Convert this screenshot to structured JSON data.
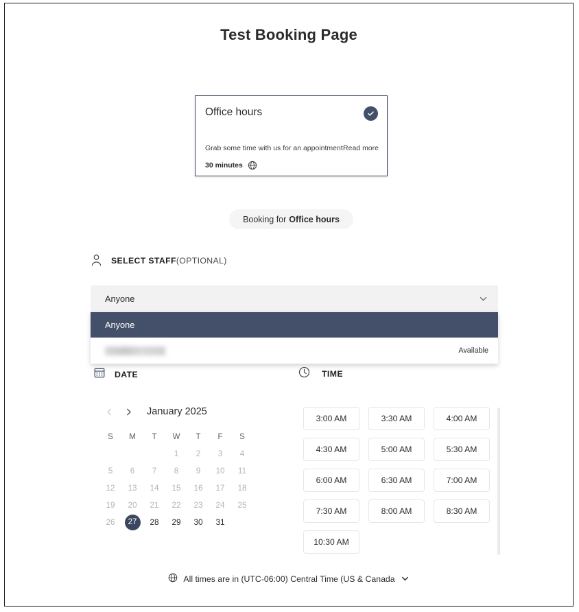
{
  "page": {
    "title": "Test Booking Page"
  },
  "service_card": {
    "title": "Office hours",
    "selected_badge_icon": "check-circle-icon",
    "description": "Grab some time with us for an appointment",
    "read_more_label": "Read more",
    "duration": "30 minutes",
    "duration_icon": "globe-icon",
    "border_color": "#3c485e",
    "badge_color": "#44506a"
  },
  "booking_pill": {
    "prefix": "Booking for",
    "service": "Office hours"
  },
  "staff": {
    "icon": "person-icon",
    "heading": "SELECT STAFF",
    "heading_optional": "(OPTIONAL)",
    "selected_value": "Anyone",
    "chevron_icon": "chevron-down-icon",
    "options": [
      {
        "label": "Anyone",
        "status": "",
        "selected": true,
        "redacted": false
      },
      {
        "label": "",
        "status": "Available",
        "selected": false,
        "redacted": true
      }
    ],
    "highlight_color": "#44506a",
    "field_bg": "#f2f2f2"
  },
  "date_section": {
    "icon": "calendar-icon",
    "label": "DATE"
  },
  "time_section": {
    "icon": "clock-icon",
    "label": "TIME"
  },
  "calendar": {
    "prev_icon": "chevron-left-icon",
    "next_icon": "chevron-right-icon",
    "prev_disabled": true,
    "month_year": "January 2025",
    "weekdays": [
      "S",
      "M",
      "T",
      "W",
      "T",
      "F",
      "S"
    ],
    "leading_blanks": 3,
    "days": [
      {
        "n": "1",
        "state": "disabled"
      },
      {
        "n": "2",
        "state": "disabled"
      },
      {
        "n": "3",
        "state": "disabled"
      },
      {
        "n": "4",
        "state": "disabled"
      },
      {
        "n": "5",
        "state": "disabled"
      },
      {
        "n": "6",
        "state": "disabled"
      },
      {
        "n": "7",
        "state": "disabled"
      },
      {
        "n": "8",
        "state": "disabled"
      },
      {
        "n": "9",
        "state": "disabled"
      },
      {
        "n": "10",
        "state": "disabled"
      },
      {
        "n": "11",
        "state": "disabled"
      },
      {
        "n": "12",
        "state": "disabled"
      },
      {
        "n": "13",
        "state": "disabled"
      },
      {
        "n": "14",
        "state": "disabled"
      },
      {
        "n": "15",
        "state": "disabled"
      },
      {
        "n": "16",
        "state": "disabled"
      },
      {
        "n": "17",
        "state": "disabled"
      },
      {
        "n": "18",
        "state": "disabled"
      },
      {
        "n": "19",
        "state": "disabled"
      },
      {
        "n": "20",
        "state": "disabled"
      },
      {
        "n": "21",
        "state": "disabled"
      },
      {
        "n": "22",
        "state": "disabled"
      },
      {
        "n": "23",
        "state": "disabled"
      },
      {
        "n": "24",
        "state": "disabled"
      },
      {
        "n": "25",
        "state": "disabled"
      },
      {
        "n": "26",
        "state": "disabled"
      },
      {
        "n": "27",
        "state": "selected"
      },
      {
        "n": "28",
        "state": "enabled"
      },
      {
        "n": "29",
        "state": "enabled"
      },
      {
        "n": "30",
        "state": "enabled"
      },
      {
        "n": "31",
        "state": "enabled"
      }
    ],
    "selected_day": "27",
    "selected_color": "#3b4761"
  },
  "time_slots": [
    "3:00 AM",
    "3:30 AM",
    "4:00 AM",
    "4:30 AM",
    "5:00 AM",
    "5:30 AM",
    "6:00 AM",
    "6:30 AM",
    "7:00 AM",
    "7:30 AM",
    "8:00 AM",
    "8:30 AM",
    "10:30 AM"
  ],
  "timezone": {
    "icon": "globe-icon",
    "text": "All times are in  (UTC-06:00) Central Time (US & Canada",
    "chevron_icon": "chevron-down-icon"
  }
}
